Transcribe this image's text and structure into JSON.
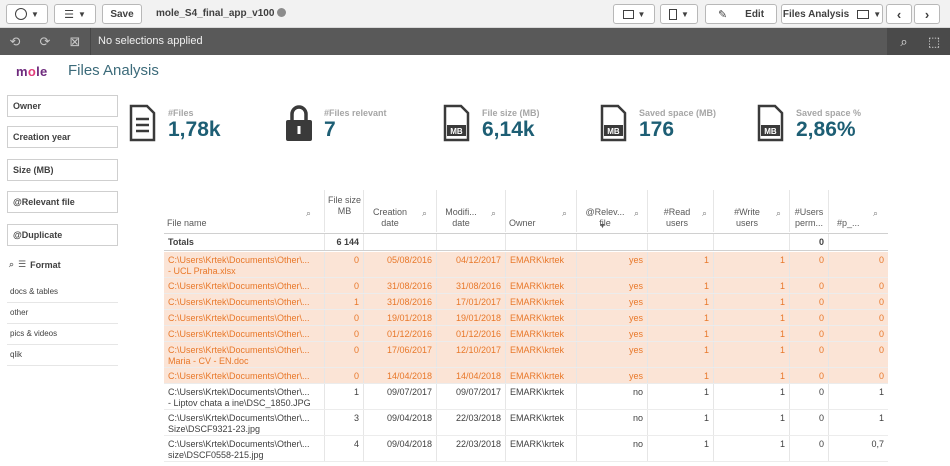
{
  "toolbar": {
    "save_label": "Save",
    "app_name": "mole_S4_final_app_v100",
    "edit_label": "Edit",
    "sheet_selector_label": "Files Analysis"
  },
  "selections": {
    "status": "No selections applied"
  },
  "sheet": {
    "logo": "mole",
    "title": "Files Analysis"
  },
  "filters": [
    "Owner",
    "Creation year",
    "Size (MB)",
    "@Relevant file",
    "@Duplicate"
  ],
  "format_filter": {
    "label": "Format",
    "items": [
      "docs & tables",
      "other",
      "pics & videos",
      "qlik"
    ]
  },
  "kpis": [
    {
      "label": "#Files",
      "value": "1,78k",
      "icon": "document-icon"
    },
    {
      "label": "#Files relevant",
      "value": "7",
      "icon": "lock-icon"
    },
    {
      "label": "File size (MB)",
      "value": "6,14k",
      "icon": "mb-file-icon"
    },
    {
      "label": "Saved space (MB)",
      "value": "176",
      "icon": "mb-file-icon"
    },
    {
      "label": "Saved space %",
      "value": "2,86%",
      "icon": "mb-file-icon"
    }
  ],
  "table": {
    "columns": [
      "File name",
      "File size MB",
      "Creation date",
      "Modifi... date",
      "Owner",
      "@Relev... file",
      "#Read users",
      "#Write users",
      "#Users perm...",
      "#p_..."
    ],
    "totals": {
      "label": "Totals",
      "size": "6 144",
      "perm": "0"
    },
    "rows": [
      {
        "sel": true,
        "name": "C:\\Users\\Krtek\\Documents\\Other\\...",
        "name2": "- UCL Praha.xlsx",
        "size": "0",
        "created": "05/08/2016",
        "modified": "04/12/2017",
        "owner": "EMARK\\krtek",
        "relevant": "yes",
        "read": "1",
        "write": "1",
        "perm": "0",
        "p": "0"
      },
      {
        "sel": true,
        "name": "C:\\Users\\Krtek\\Documents\\Other\\...",
        "name2": "",
        "size": "0",
        "created": "31/08/2016",
        "modified": "31/08/2016",
        "owner": "EMARK\\krtek",
        "relevant": "yes",
        "read": "1",
        "write": "1",
        "perm": "0",
        "p": "0"
      },
      {
        "sel": true,
        "name": "C:\\Users\\Krtek\\Documents\\Other\\...",
        "name2": "",
        "size": "1",
        "created": "31/08/2016",
        "modified": "17/01/2017",
        "owner": "EMARK\\krtek",
        "relevant": "yes",
        "read": "1",
        "write": "1",
        "perm": "0",
        "p": "0"
      },
      {
        "sel": true,
        "name": "C:\\Users\\Krtek\\Documents\\Other\\...",
        "name2": "",
        "size": "0",
        "created": "19/01/2018",
        "modified": "19/01/2018",
        "owner": "EMARK\\krtek",
        "relevant": "yes",
        "read": "1",
        "write": "1",
        "perm": "0",
        "p": "0"
      },
      {
        "sel": true,
        "name": "C:\\Users\\Krtek\\Documents\\Other\\...",
        "name2": "",
        "size": "0",
        "created": "01/12/2016",
        "modified": "01/12/2016",
        "owner": "EMARK\\krtek",
        "relevant": "yes",
        "read": "1",
        "write": "1",
        "perm": "0",
        "p": "0"
      },
      {
        "sel": true,
        "name": "C:\\Users\\Krtek\\Documents\\Other\\...",
        "name2": "Maria - CV - EN.doc",
        "size": "0",
        "created": "17/06/2017",
        "modified": "12/10/2017",
        "owner": "EMARK\\krtek",
        "relevant": "yes",
        "read": "1",
        "write": "1",
        "perm": "0",
        "p": "0"
      },
      {
        "sel": true,
        "name": "C:\\Users\\Krtek\\Documents\\Other\\...",
        "name2": "",
        "size": "0",
        "created": "14/04/2018",
        "modified": "14/04/2018",
        "owner": "EMARK\\krtek",
        "relevant": "yes",
        "read": "1",
        "write": "1",
        "perm": "0",
        "p": "0"
      },
      {
        "sel": false,
        "name": "C:\\Users\\Krtek\\Documents\\Other\\...",
        "name2": "- Liptov chata a ine\\DSC_1850.JPG",
        "size": "1",
        "created": "09/07/2017",
        "modified": "09/07/2017",
        "owner": "EMARK\\krtek",
        "relevant": "no",
        "read": "1",
        "write": "1",
        "perm": "0",
        "p": "1"
      },
      {
        "sel": false,
        "name": "C:\\Users\\Krtek\\Documents\\Other\\...",
        "name2": "Size\\DSCF9321-23.jpg",
        "size": "3",
        "created": "09/04/2018",
        "modified": "22/03/2018",
        "owner": "EMARK\\krtek",
        "relevant": "no",
        "read": "1",
        "write": "1",
        "perm": "0",
        "p": "1"
      },
      {
        "sel": false,
        "name": "C:\\Users\\Krtek\\Documents\\Other\\...",
        "name2": "size\\DSCF0558-215.jpg",
        "size": "4",
        "created": "09/04/2018",
        "modified": "22/03/2018",
        "owner": "EMARK\\krtek",
        "relevant": "no",
        "read": "1",
        "write": "1",
        "perm": "0",
        "p": "0,7"
      }
    ]
  },
  "colors": {
    "kpi_value": "#1d5e74",
    "selected_row": "#fbe4d6",
    "selected_text": "#e8782a",
    "selection_bar": "#595959"
  }
}
